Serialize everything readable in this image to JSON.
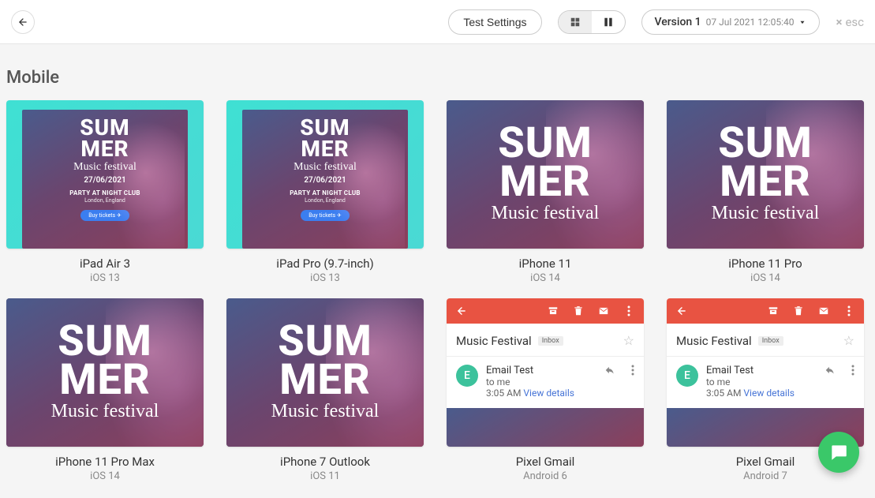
{
  "topbar": {
    "test_settings_label": "Test Settings",
    "version_name": "Version 1",
    "version_date": "07 Jul 2021 12:05:40",
    "esc_label": "esc"
  },
  "section_title": "Mobile",
  "poster": {
    "line1": "SUM",
    "line2": "MER",
    "subtitle": "Music festival",
    "date": "27/06/2021",
    "party": "PARTY AT NIGHT CLUB",
    "city": "London, England",
    "cta": "Buy tickets ✈"
  },
  "gmail": {
    "subject": "Music Festival",
    "inbox_label": "Inbox",
    "sender": "Email Test",
    "to_line": "to me",
    "time": "3:05 AM",
    "view_details": "View details",
    "avatar_initial": "E"
  },
  "cards": [
    {
      "name": "iPad Air 3",
      "os": "iOS 13",
      "type": "teal"
    },
    {
      "name": "iPad Pro (9.7-inch)",
      "os": "iOS 13",
      "type": "teal"
    },
    {
      "name": "iPhone 11",
      "os": "iOS 14",
      "type": "full"
    },
    {
      "name": "iPhone 11 Pro",
      "os": "iOS 14",
      "type": "full"
    },
    {
      "name": "iPhone 11 Pro Max",
      "os": "iOS 14",
      "type": "full"
    },
    {
      "name": "iPhone 7 Outlook",
      "os": "iOS 11",
      "type": "full"
    },
    {
      "name": "Pixel Gmail",
      "os": "Android 6",
      "type": "gmail"
    },
    {
      "name": "Pixel Gmail",
      "os": "Android 7",
      "type": "gmail"
    }
  ]
}
